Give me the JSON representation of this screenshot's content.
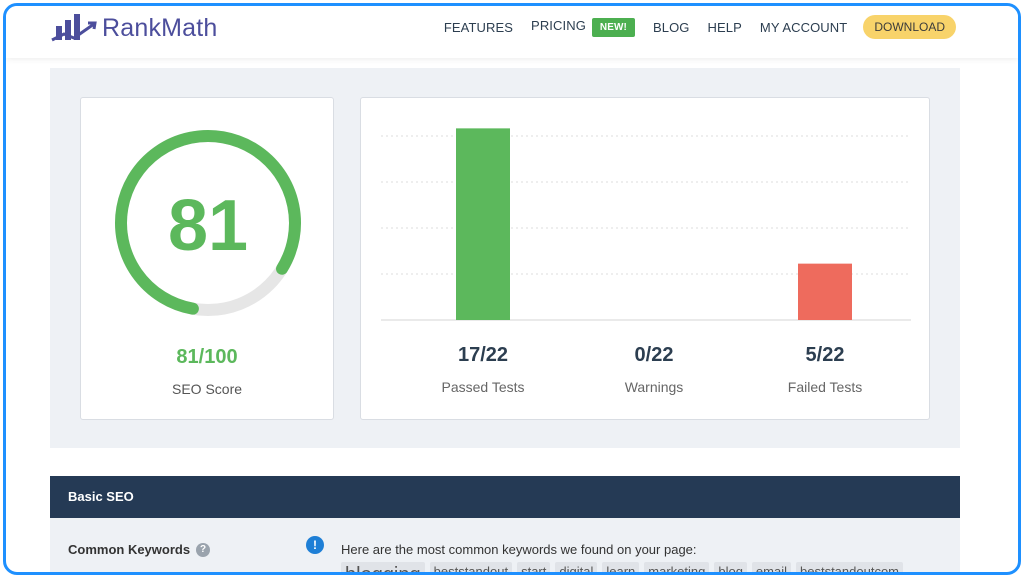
{
  "brand": {
    "name": "RankMath",
    "logo_icon": "bar-chart-arrow-icon",
    "colors": {
      "logo": "#4c4e9c",
      "green": "#5cb85c",
      "red": "#ee6b5d",
      "navy": "#253a55",
      "download": "#f8d36a"
    }
  },
  "nav": {
    "features": "FEATURES",
    "pricing": "PRICING",
    "pricing_badge": "NEW!",
    "blog": "BLOG",
    "help": "HELP",
    "account": "MY ACCOUNT",
    "download": "DOWNLOAD"
  },
  "score": {
    "value": "81",
    "fraction": "81/100",
    "label": "SEO Score",
    "percent": 81
  },
  "chart_data": {
    "type": "bar",
    "categories": [
      "Passed Tests",
      "Warnings",
      "Failed Tests"
    ],
    "values": [
      17,
      0,
      5
    ],
    "ylim": [
      0,
      22
    ],
    "colors": [
      "#5cb85c",
      "#f0ad4e",
      "#ee6b5d"
    ],
    "grid": true
  },
  "stats": [
    {
      "value": "17/22",
      "label": "Passed Tests"
    },
    {
      "value": "0/22",
      "label": "Warnings"
    },
    {
      "value": "5/22",
      "label": "Failed Tests"
    }
  ],
  "basic_seo": {
    "title": "Basic SEO",
    "common_keywords_label": "Common Keywords",
    "help_icon": "question-icon",
    "info_icon": "exclamation-icon",
    "description": "Here are the most common keywords we found on your page:",
    "keywords": [
      "blogging",
      "beststandout",
      "start",
      "digital",
      "learn",
      "marketing",
      "blog",
      "email",
      "beststandoutcom"
    ]
  }
}
